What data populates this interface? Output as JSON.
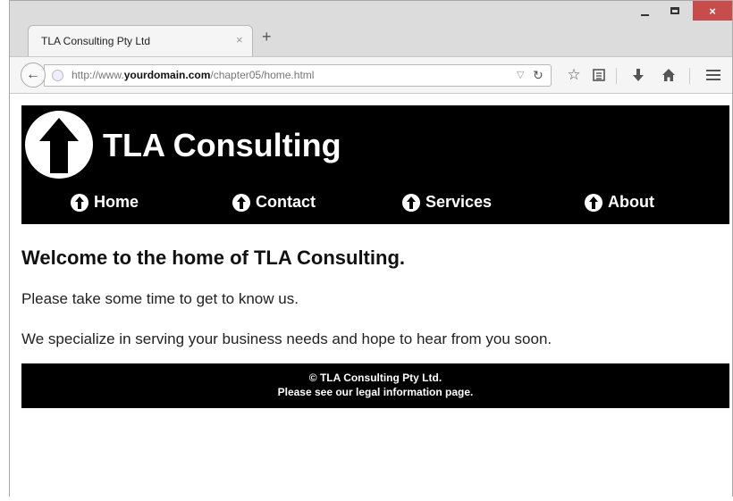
{
  "browser": {
    "tab_title": "TLA Consulting Pty Ltd",
    "tab_close": "×",
    "new_tab": "+",
    "url_prefix": "http://www.",
    "url_domain": "yourdomain.com",
    "url_path": "/chapter05/home.html",
    "window_close": "×",
    "accent_close": "#c94c4c"
  },
  "site": {
    "title": "TLA Consulting",
    "nav": [
      {
        "label": "Home",
        "icon": "up-arrow-icon"
      },
      {
        "label": "Contact",
        "icon": "up-arrow-icon"
      },
      {
        "label": "Services",
        "icon": "up-arrow-icon"
      },
      {
        "label": "About",
        "icon": "up-arrow-icon"
      }
    ],
    "heading": "Welcome to the home of TLA Consulting.",
    "paragraph1": "Please take some time to get to know us.",
    "paragraph2": "We specialize in serving your business needs and hope to hear from you soon.",
    "footer_line1": "© TLA Consulting Pty Ltd.",
    "footer_line2": "Please see our legal information page."
  }
}
